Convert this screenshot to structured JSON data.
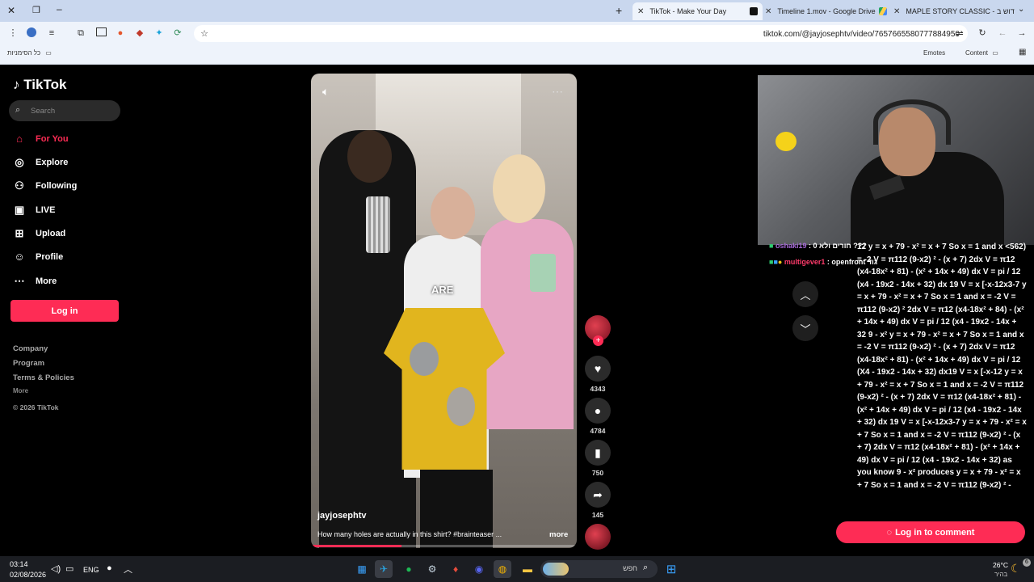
{
  "browser": {
    "tabs": [
      {
        "title": "TikTok - Make Your Day",
        "active": true
      },
      {
        "title": "Timeline 1.mov - Google Drive",
        "active": false
      },
      {
        "title": "MAPLE STORY CLASSIC - קדוש ב",
        "active": false
      }
    ],
    "url": "tiktok.com/@jayjosephtv/video/7657665580777884950",
    "bookmarks_label": "כל הסימניות",
    "bookmark_right": [
      "Emotes",
      "Content"
    ]
  },
  "tiktok": {
    "logo": "TikTok",
    "search_placeholder": "Search",
    "nav": [
      {
        "label": "For You",
        "icon": "home-icon",
        "active": true
      },
      {
        "label": "Explore",
        "icon": "compass-icon"
      },
      {
        "label": "Following",
        "icon": "following-icon"
      },
      {
        "label": "LIVE",
        "icon": "live-icon"
      },
      {
        "label": "Upload",
        "icon": "upload-icon"
      },
      {
        "label": "Profile",
        "icon": "profile-icon"
      },
      {
        "label": "More",
        "icon": "more-icon"
      }
    ],
    "login_label": "Log in",
    "footer": [
      "Company",
      "Program",
      "Terms & Policies",
      "More",
      "© 2026 TikTok"
    ]
  },
  "video": {
    "author": "jayjosephtv",
    "caption": "How many holes are actually in this shirt? #brainteaser ...",
    "more_label": "more",
    "overlay_text": "ARE",
    "likes": "4343",
    "comments": "4784",
    "saves": "750",
    "shares": "145",
    "progress": 0.34
  },
  "chat": {
    "line1_user": "oshaki19",
    "line1_text": ": 0 חורים ולא ???",
    "line2_user": "multigever1",
    "line2_text": ": openfront גוד"
  },
  "math_overlay": "12 y = x + 79 - x² = x + 7 So x = 1 and x <562) = -2 V = π112 (9-x2) ² - (x + 7) 2dx V = π12 (x4-18x² + 81) - (x² + 14x + 49) dx V = pi / 12 (x4 - 19x2 - 14x + 32) dx 19 V = x [-x-12x3-7 y = x + 79 - x² = x + 7 So x = 1 and x = -2 V = π112 (9-x2) ² 2dx V = π12 (x4-18x² + 84) - (x² + 14x + 49) dx V = pi / 12 (x4 - 19x2 - 14x + 32 9 - x² y = x + 79 - x² = x + 7 So x = 1 and x = -2 V = π112 (9-x2) ² - (x + 7) 2dx V = π12 (x4-18x² + 81) - (x² + 14x + 49) dx V = pi / 12 (X4 - 19x2 - 14x + 32) dx19 V = x [-x-12 y = x + 79 - x² = x + 7 So x = 1 and x = -2 V = π112 (9-x2) ² - (x + 7) 2dx V = π12 (x4-18x² + 81) - (x² + 14x + 49) dx V = pi / 12 (x4 - 19x2 - 14x + 32) dx 19 V = x [-x-12x3-7 y = x + 79 - x² = x + 7 So x = 1 and x = -2 V = π112 (9-x2) ² - (x + 7) 2dx V = π12 (x4-18x² + 81) - (x² + 14x + 49) dx V = pi / 12 (x4 - 19x2 - 14x + 32) as you know 9 - x² produces y = x + 79 - x² = x + 7 So x = 1 and x = -2 V = π112 (9-x2) ² -",
  "comment_button": "Log in to comment",
  "taskbar": {
    "time": "03:14",
    "date": "02/08/2026",
    "lang": "ENG",
    "search_placeholder": "חפש",
    "weather_temp": "26°C",
    "weather_label": "בהיר",
    "notif_count": "6"
  },
  "colors": {
    "accent": "#fe2c55",
    "tabbar": "#c9d7ee",
    "toolbar": "#eef3fb"
  }
}
